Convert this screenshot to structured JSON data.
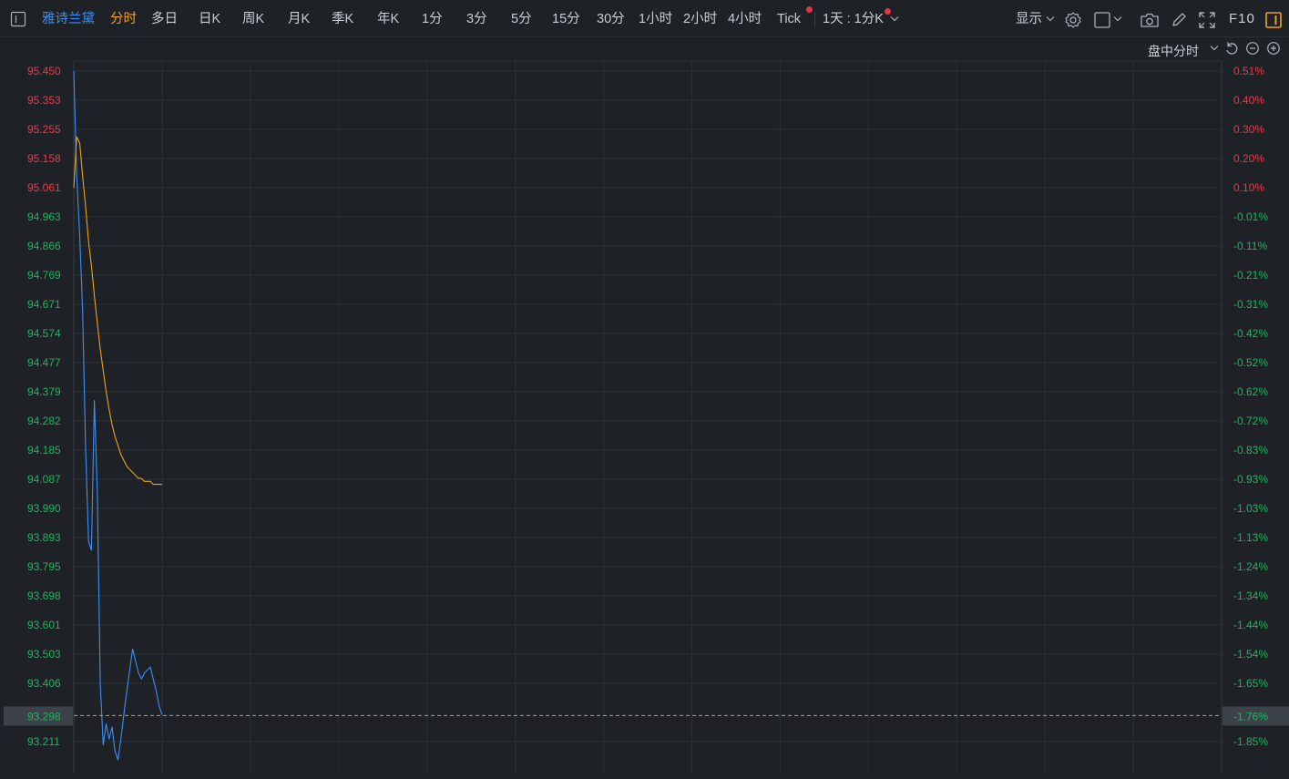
{
  "toolbar": {
    "symbol": "雅诗兰黛",
    "active_period": "分时",
    "periods": [
      "多日",
      "日K",
      "周K",
      "月K",
      "季K",
      "年K",
      "1分",
      "3分",
      "5分",
      "15分",
      "30分",
      "1小时",
      "2小时",
      "4小时",
      "Tick"
    ],
    "range_selector": "1天 : 1分K",
    "display_label": "显示",
    "f10_label": "F10"
  },
  "subbar": {
    "session_label": "盘中分时"
  },
  "colors": {
    "up": "#f23645",
    "down": "#1fb55c",
    "price_line": "#3d8ef8",
    "avg_line": "#f0a020",
    "accent": "#f0a020",
    "grid": "#2a3036"
  },
  "chart_data": {
    "type": "line",
    "title": "",
    "xlabel": "",
    "ylabel": "",
    "ylim": [
      93.16,
      95.483
    ],
    "y_ticks": [
      "95.450",
      "95.353",
      "95.255",
      "95.158",
      "95.061",
      "94.963",
      "94.866",
      "94.769",
      "94.671",
      "94.574",
      "94.477",
      "94.379",
      "94.282",
      "94.185",
      "94.087",
      "93.990",
      "93.893",
      "93.795",
      "93.698",
      "93.601",
      "93.503",
      "93.406",
      "93.211"
    ],
    "y_tick_values": [
      95.45,
      95.353,
      95.255,
      95.158,
      95.061,
      94.963,
      94.866,
      94.769,
      94.671,
      94.574,
      94.477,
      94.379,
      94.282,
      94.185,
      94.087,
      93.99,
      93.893,
      93.795,
      93.698,
      93.601,
      93.503,
      93.406,
      93.211
    ],
    "pct_ticks": [
      "0.51%",
      "0.40%",
      "0.30%",
      "0.20%",
      "0.10%",
      "-0.01%",
      "-0.11%",
      "-0.21%",
      "-0.31%",
      "-0.42%",
      "-0.52%",
      "-0.62%",
      "-0.72%",
      "-0.83%",
      "-0.93%",
      "-1.03%",
      "-1.13%",
      "-1.24%",
      "-1.34%",
      "-1.44%",
      "-1.54%",
      "-1.65%",
      "-1.85%"
    ],
    "current_price": "93.298",
    "current_price_value": 93.298,
    "current_pct": "-1.76%",
    "x_total_minutes": 390,
    "grid": true,
    "series": [
      {
        "key": "price",
        "x": [
          0,
          1,
          2,
          3,
          4,
          5,
          6,
          7,
          8,
          9,
          10,
          11,
          12,
          13,
          14,
          15,
          16,
          17,
          18,
          19,
          20,
          21,
          22,
          23,
          24,
          25,
          26,
          27,
          28,
          29,
          30
        ],
        "values": [
          95.45,
          95.1,
          94.9,
          94.65,
          94.2,
          93.88,
          93.85,
          94.35,
          94.05,
          93.4,
          93.2,
          93.27,
          93.22,
          93.26,
          93.18,
          93.15,
          93.22,
          93.3,
          93.38,
          93.45,
          93.52,
          93.48,
          93.44,
          93.42,
          93.44,
          93.45,
          93.46,
          93.42,
          93.38,
          93.33,
          93.3
        ]
      },
      {
        "key": "average",
        "x": [
          0,
          1,
          2,
          3,
          4,
          5,
          6,
          7,
          8,
          9,
          10,
          11,
          12,
          13,
          14,
          15,
          16,
          17,
          18,
          19,
          20,
          21,
          22,
          23,
          24,
          25,
          26,
          27,
          28,
          29,
          30
        ],
        "values": [
          95.06,
          95.23,
          95.21,
          95.1,
          95.0,
          94.88,
          94.8,
          94.7,
          94.61,
          94.52,
          94.45,
          94.38,
          94.32,
          94.27,
          94.23,
          94.2,
          94.17,
          94.15,
          94.13,
          94.12,
          94.11,
          94.1,
          94.09,
          94.09,
          94.08,
          94.08,
          94.08,
          94.07,
          94.07,
          94.07,
          94.07
        ]
      }
    ]
  }
}
